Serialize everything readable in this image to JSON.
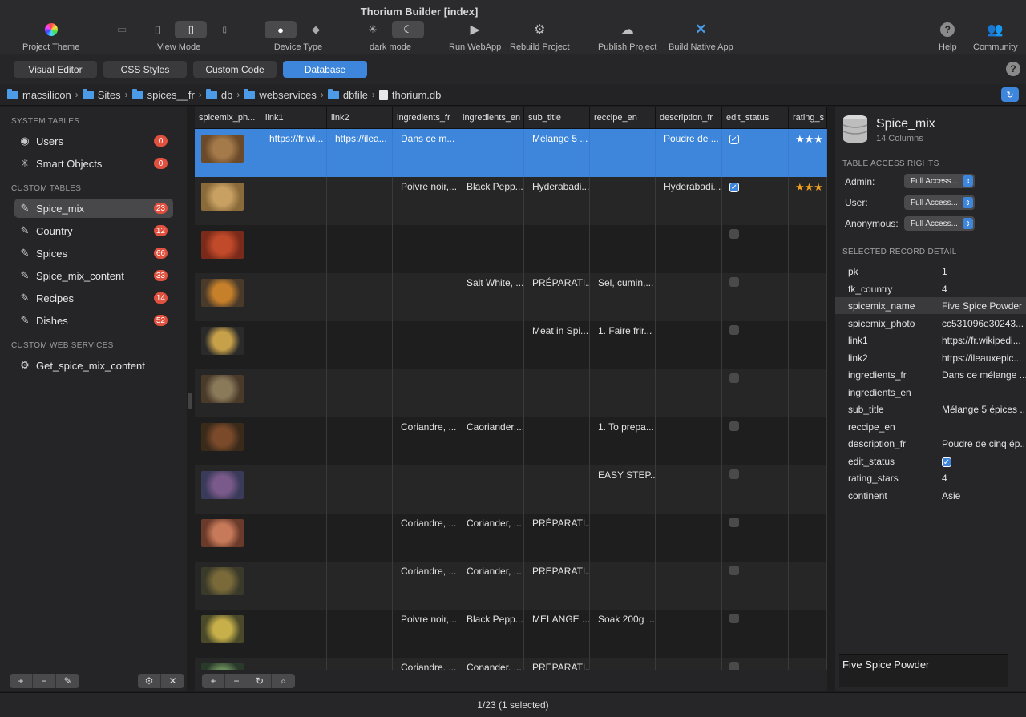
{
  "window": {
    "title": "Thorium Builder  [index]"
  },
  "toolbar": {
    "project_theme": "Project Theme",
    "view_mode": "View Mode",
    "device_type": "Device Type",
    "dark_mode": "dark mode",
    "run_webapp": "Run WebApp",
    "rebuild_project": "Rebuild Project",
    "publish_project": "Publish Project",
    "build_native_app": "Build Native App",
    "help": "Help",
    "community": "Community"
  },
  "tabs": [
    "Visual Editor",
    "CSS Styles",
    "Custom Code",
    "Database"
  ],
  "active_tab": "Database",
  "breadcrumb": [
    "macsilicon",
    "Sites",
    "spices__fr",
    "db",
    "webservices",
    "dbfile",
    "thorium.db"
  ],
  "sidebar": {
    "system_tables_title": "SYSTEM TABLES",
    "system_tables": [
      {
        "label": "Users",
        "count": "0"
      },
      {
        "label": "Smart Objects",
        "count": "0"
      }
    ],
    "custom_tables_title": "CUSTOM TABLES",
    "custom_tables": [
      {
        "label": "Spice_mix",
        "count": "23"
      },
      {
        "label": "Country",
        "count": "12"
      },
      {
        "label": "Spices",
        "count": "66"
      },
      {
        "label": "Spice_mix_content",
        "count": "33"
      },
      {
        "label": "Recipes",
        "count": "14"
      },
      {
        "label": "Dishes",
        "count": "52"
      }
    ],
    "web_services_title": "CUSTOM WEB SERVICES",
    "web_services": [
      {
        "label": "Get_spice_mix_content"
      }
    ]
  },
  "grid": {
    "columns": [
      "spicemix_ph...",
      "link1",
      "link2",
      "ingredients_fr",
      "ingredients_en",
      "sub_title",
      "reccipe_en",
      "description_fr",
      "edit_status",
      "rating_s"
    ],
    "rows": [
      {
        "link1": "https://fr.wi...",
        "link2": "https://ilea...",
        "ingredients_fr": "Dans ce m...",
        "ingredients_en": "",
        "sub_title": "Mélange 5 ...",
        "reccipe_en": "",
        "description_fr": "Poudre de ...",
        "edit_status": true,
        "stars": "★★★"
      },
      {
        "link1": "",
        "link2": "",
        "ingredients_fr": "Poivre noir,...",
        "ingredients_en": "Black Pepp...",
        "sub_title": "Hyderabadi...",
        "reccipe_en": "",
        "description_fr": "Hyderabadi...",
        "edit_status": true,
        "stars": "★★★"
      },
      {
        "link1": "",
        "link2": "",
        "ingredients_fr": "",
        "ingredients_en": "",
        "sub_title": "",
        "reccipe_en": "",
        "description_fr": "",
        "edit_status": false,
        "stars": ""
      },
      {
        "link1": "",
        "link2": "",
        "ingredients_fr": "",
        "ingredients_en": "Salt White, ...",
        "sub_title": "PRÉPARATI...",
        "reccipe_en": "Sel, cumin,...",
        "description_fr": "",
        "edit_status": false,
        "stars": ""
      },
      {
        "link1": "",
        "link2": "",
        "ingredients_fr": "",
        "ingredients_en": "",
        "sub_title": "Meat in Spi...",
        "reccipe_en": "1. Faire frir...",
        "description_fr": "",
        "edit_status": false,
        "stars": ""
      },
      {
        "link1": "",
        "link2": "",
        "ingredients_fr": "",
        "ingredients_en": "",
        "sub_title": "",
        "reccipe_en": "",
        "description_fr": "",
        "edit_status": false,
        "stars": ""
      },
      {
        "link1": "",
        "link2": "",
        "ingredients_fr": "Coriandre, ...",
        "ingredients_en": "Caoriander,...",
        "sub_title": "",
        "reccipe_en": "1. To prepa...",
        "description_fr": "",
        "edit_status": false,
        "stars": ""
      },
      {
        "link1": "",
        "link2": "",
        "ingredients_fr": "",
        "ingredients_en": "",
        "sub_title": "",
        "reccipe_en": "EASY STEP...",
        "description_fr": "",
        "edit_status": false,
        "stars": ""
      },
      {
        "link1": "",
        "link2": "",
        "ingredients_fr": "Coriandre, ...",
        "ingredients_en": "Coriander, ...",
        "sub_title": "PRÉPARATI...",
        "reccipe_en": "",
        "description_fr": "",
        "edit_status": false,
        "stars": ""
      },
      {
        "link1": "",
        "link2": "",
        "ingredients_fr": "Coriandre, ...",
        "ingredients_en": "Coriander, ...",
        "sub_title": "PREPARATI...",
        "reccipe_en": "",
        "description_fr": "",
        "edit_status": false,
        "stars": ""
      },
      {
        "link1": "",
        "link2": "",
        "ingredients_fr": "Poivre noir,...",
        "ingredients_en": "Black Pepp...",
        "sub_title": "MELANGE ...",
        "reccipe_en": "Soak 200g ...",
        "description_fr": "",
        "edit_status": false,
        "stars": ""
      },
      {
        "link1": "",
        "link2": "",
        "ingredients_fr": "Coriandre, ...",
        "ingredients_en": "Conander, ...",
        "sub_title": "PREPARATI...",
        "reccipe_en": "",
        "description_fr": "",
        "edit_status": false,
        "stars": ""
      }
    ]
  },
  "right_panel": {
    "table_name": "Spice_mix",
    "column_count": "14 Columns",
    "access_title": "TABLE ACCESS RIGHTS",
    "access": [
      {
        "role": "Admin:",
        "value": "Full Access..."
      },
      {
        "role": "User:",
        "value": "Full Access..."
      },
      {
        "role": "Anonymous:",
        "value": "Full Access..."
      }
    ],
    "detail_title": "SELECTED RECORD DETAIL",
    "details": [
      {
        "key": "pk",
        "value": "1"
      },
      {
        "key": "fk_country",
        "value": "4"
      },
      {
        "key": "spicemix_name",
        "value": "Five Spice Powder"
      },
      {
        "key": "spicemix_photo",
        "value": "cc531096e30243..."
      },
      {
        "key": "link1",
        "value": "https://fr.wikipedi..."
      },
      {
        "key": "link2",
        "value": "https://ileauxepic..."
      },
      {
        "key": "ingredients_fr",
        "value": "Dans ce mélange ..."
      },
      {
        "key": "ingredients_en",
        "value": ""
      },
      {
        "key": "sub_title",
        "value": "Mélange 5 épices ..."
      },
      {
        "key": "reccipe_en",
        "value": ""
      },
      {
        "key": "description_fr",
        "value": "Poudre de cinq ép..."
      },
      {
        "key": "edit_status",
        "value": ""
      },
      {
        "key": "rating_stars",
        "value": "4"
      },
      {
        "key": "continent",
        "value": "Asie"
      }
    ],
    "field_value": "Five Spice Powder"
  },
  "status": "1/23 (1 selected)",
  "colors": {
    "accent": "#3d86dc",
    "badge": "#e0513f",
    "star": "#f0a020"
  }
}
